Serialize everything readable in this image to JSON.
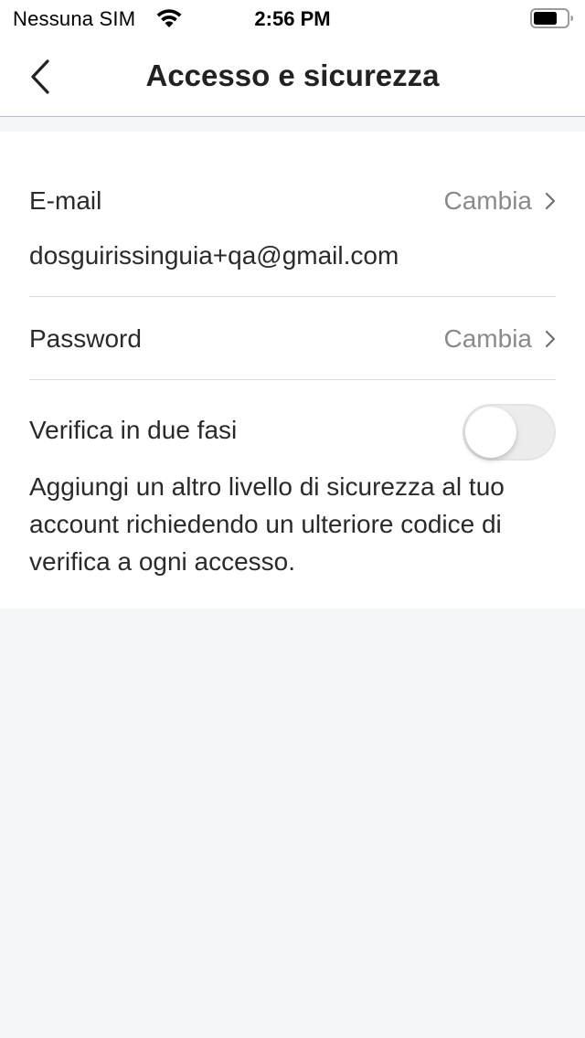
{
  "status_bar": {
    "carrier": "Nessuna SIM",
    "time": "2:56 PM",
    "icons": [
      "wifi-icon",
      "battery-icon"
    ]
  },
  "nav": {
    "title": "Accesso e sicurezza",
    "back_icon": "chevron-left-icon"
  },
  "email": {
    "label": "E-mail",
    "action": "Cambia",
    "value": "dosguirissinguia+qa@gmail.com"
  },
  "password": {
    "label": "Password",
    "action": "Cambia"
  },
  "two_factor": {
    "label": "Verifica in due fasi",
    "enabled": false,
    "description": "Aggiungi un altro livello di sicurezza al tuo account richiedendo un ulteriore codice di verifica a ogni accesso."
  },
  "colors": {
    "background": "#f4f5f9",
    "card": "#ffffff",
    "text": "#222222",
    "muted": "#8a8a8a",
    "divider": "#dadbe0"
  }
}
